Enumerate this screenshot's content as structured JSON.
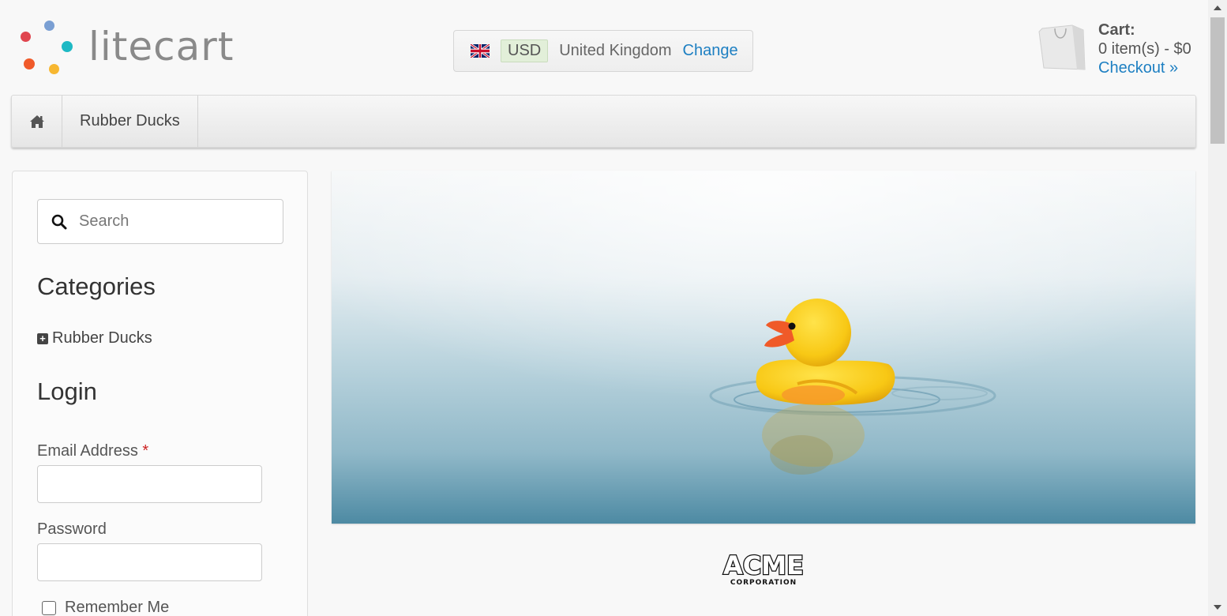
{
  "brand": {
    "name": "litecart"
  },
  "region": {
    "flag_icon": "uk-flag-icon",
    "currency": "USD",
    "country": "United Kingdom",
    "change_label": "Change"
  },
  "cart": {
    "title": "Cart:",
    "summary": "0 item(s) - $0",
    "checkout_label": "Checkout »",
    "icon": "shopping-bag-icon"
  },
  "nav": {
    "home_icon": "home-icon",
    "items": [
      {
        "label": "Rubber Ducks"
      }
    ]
  },
  "sidebar": {
    "search": {
      "placeholder": "Search",
      "icon": "search-icon"
    },
    "categories": {
      "heading": "Categories",
      "items": [
        {
          "label": "Rubber Ducks",
          "icon": "plus-square-icon"
        }
      ]
    },
    "login": {
      "heading": "Login",
      "email_label": "Email Address",
      "required_mark": "*",
      "password_label": "Password",
      "remember_label": "Remember Me"
    }
  },
  "main": {
    "banner": {
      "subject": "rubber duck on water"
    },
    "manufacturer_logo": {
      "text": "ACME",
      "subtext": "CORPORATION"
    }
  },
  "colors": {
    "link": "#1d7fc2",
    "brand_dots": [
      "#e0464f",
      "#7a9fd3",
      "#1eb9c4",
      "#f05a2a",
      "#f7b731"
    ]
  }
}
